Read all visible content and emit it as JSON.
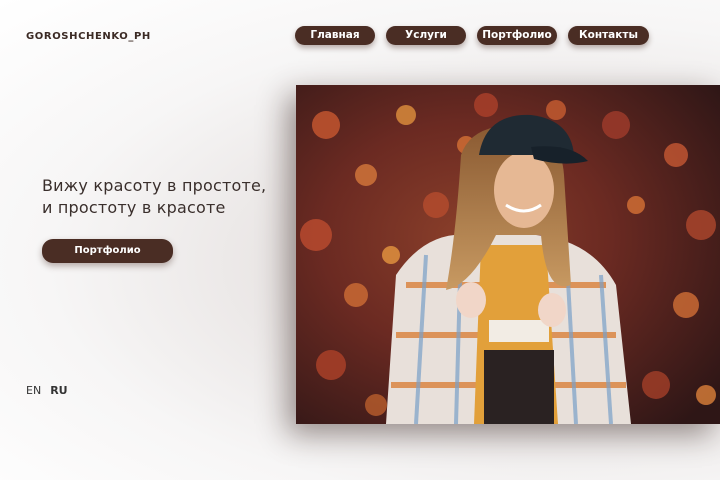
{
  "brand": {
    "logo_text": "GOROSHCHENKO_PH"
  },
  "nav": {
    "items": [
      {
        "label": "Главная"
      },
      {
        "label": "Услуги"
      },
      {
        "label": "Портфолио"
      },
      {
        "label": "Контакты"
      }
    ]
  },
  "hero": {
    "tagline_line1": "Вижу красоту в простоте,",
    "tagline_line2": "и простоту в красоте",
    "cta_label": "Портфолио"
  },
  "language": {
    "options": [
      "EN",
      "RU"
    ],
    "active": "RU"
  },
  "colors": {
    "accent": "#4a2d24",
    "text": "#3a2f2c",
    "background": "#ffffff"
  }
}
